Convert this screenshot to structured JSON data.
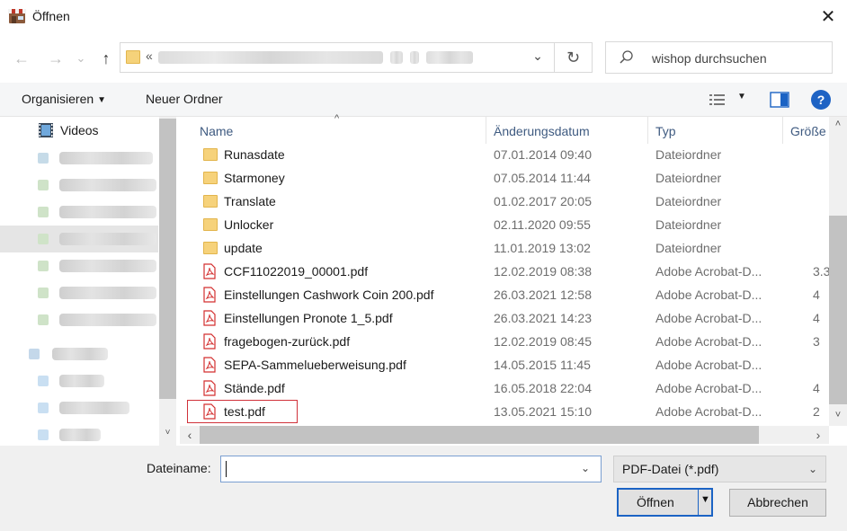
{
  "window": {
    "title": "Öffnen",
    "close_glyph": "✕",
    "app_icon": "shop-icon"
  },
  "nav": {
    "back_glyph": "←",
    "forward_glyph": "→",
    "recent_glyph": "⌄",
    "up_glyph": "↑",
    "address_chevron": "«",
    "address_dropdown_glyph": "⌄",
    "refresh_glyph": "↻"
  },
  "search": {
    "placeholder": "wishop durchsuchen",
    "icon": "search-icon"
  },
  "toolbar": {
    "organize_label": "Organisieren",
    "organize_arrow": "▼",
    "new_folder_label": "Neuer Ordner",
    "view_arrow": "▼",
    "help_glyph": "?"
  },
  "sidebar": {
    "videos_label": "Videos"
  },
  "columns": {
    "name": "Name",
    "date": "Änderungsdatum",
    "type": "Typ",
    "size": "Größe",
    "sort_glyph": "^"
  },
  "files": [
    {
      "name": "Runasdate",
      "date": "07.01.2014 09:40",
      "type": "Dateiordner",
      "size": "",
      "kind": "folder"
    },
    {
      "name": "Starmoney",
      "date": "07.05.2014 11:44",
      "type": "Dateiordner",
      "size": "",
      "kind": "folder"
    },
    {
      "name": "Translate",
      "date": "01.02.2017 20:05",
      "type": "Dateiordner",
      "size": "",
      "kind": "folder"
    },
    {
      "name": "Unlocker",
      "date": "02.11.2020 09:55",
      "type": "Dateiordner",
      "size": "",
      "kind": "folder"
    },
    {
      "name": "update",
      "date": "11.01.2019 13:02",
      "type": "Dateiordner",
      "size": "",
      "kind": "folder"
    },
    {
      "name": "CCF11022019_00001.pdf",
      "date": "12.02.2019 08:38",
      "type": "Adobe Acrobat-D...",
      "size": "3.3",
      "kind": "pdf"
    },
    {
      "name": "Einstellungen Cashwork Coin 200.pdf",
      "date": "26.03.2021 12:58",
      "type": "Adobe Acrobat-D...",
      "size": "4",
      "kind": "pdf"
    },
    {
      "name": "Einstellungen Pronote 1_5.pdf",
      "date": "26.03.2021 14:23",
      "type": "Adobe Acrobat-D...",
      "size": "4",
      "kind": "pdf"
    },
    {
      "name": "fragebogen-zurück.pdf",
      "date": "12.02.2019 08:45",
      "type": "Adobe Acrobat-D...",
      "size": "3",
      "kind": "pdf"
    },
    {
      "name": "SEPA-Sammelueberweisung.pdf",
      "date": "14.05.2015 11:45",
      "type": "Adobe Acrobat-D...",
      "size": "",
      "kind": "pdf"
    },
    {
      "name": "Stände.pdf",
      "date": "16.05.2018 22:04",
      "type": "Adobe Acrobat-D...",
      "size": "4",
      "kind": "pdf"
    },
    {
      "name": "test.pdf",
      "date": "13.05.2021 15:10",
      "type": "Adobe Acrobat-D...",
      "size": "2",
      "kind": "pdf"
    }
  ],
  "footer": {
    "filename_label": "Dateiname:",
    "filename_value": "",
    "filename_dropdown_glyph": "⌄",
    "filter_value": "PDF-Datei (*.pdf)",
    "filter_dropdown_glyph": "⌄",
    "open_label": "Öffnen",
    "open_split_glyph": "▼",
    "cancel_label": "Abbrechen"
  },
  "scroll": {
    "up": "˄",
    "down": "˅",
    "left": "‹",
    "right": "›"
  },
  "colors": {
    "accent": "#1b63c4",
    "selection_outline": "#d0313a",
    "folder": "#f6d27b",
    "pdf": "#d32f2f"
  }
}
